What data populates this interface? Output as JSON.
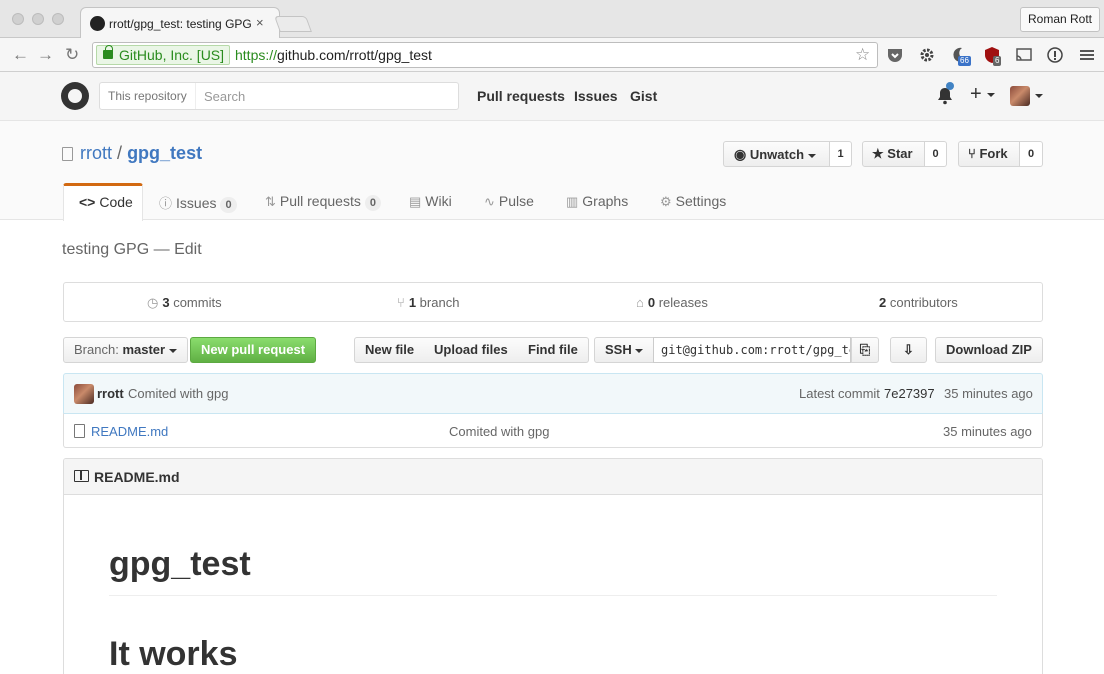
{
  "browser": {
    "tab_title": "rrott/gpg_test: testing GPG",
    "tab_close": "×",
    "profile_name": "Roman Rott",
    "ev_label": "GitHub, Inc. [US]",
    "url_scheme": "https://",
    "url_rest": "github.com/rrott/gpg_test",
    "nav_back": "←",
    "nav_forward": "→",
    "nav_reload": "↻",
    "bookmark_star": "☆",
    "ext_badge_moon": "66",
    "ext_badge_ublock": "6"
  },
  "gh_header": {
    "search_scope": "This repository",
    "search_placeholder": "Search",
    "nav": [
      "Pull requests",
      "Issues",
      "Gist"
    ],
    "plus_glyph": "+"
  },
  "repo": {
    "owner": "rrott",
    "separator": "/",
    "name": "gpg_test",
    "watch_label": "Unwatch",
    "watch_count": "1",
    "star_label": "Star",
    "star_count": "0",
    "fork_label": "Fork",
    "fork_count": "0",
    "tabs": [
      {
        "label": "Code",
        "icon": "<>"
      },
      {
        "label": "Issues",
        "count": "0"
      },
      {
        "label": "Pull requests",
        "count": "0"
      },
      {
        "label": "Wiki"
      },
      {
        "label": "Pulse"
      },
      {
        "label": "Graphs"
      },
      {
        "label": "Settings"
      }
    ],
    "description": "testing GPG",
    "desc_sep": "—",
    "edit_label": "Edit"
  },
  "summary": {
    "commits_count": "3",
    "commits_label": "commits",
    "branch_count": "1",
    "branch_label": "branch",
    "releases_count": "0",
    "releases_label": "releases",
    "contributors_count": "2",
    "contributors_label": "contributors"
  },
  "filebar": {
    "branch_prefix": "Branch:",
    "branch_name": "master",
    "new_pr": "New pull request",
    "new_file": "New file",
    "upload_files": "Upload files",
    "find_file": "Find file",
    "clone_protocol": "SSH",
    "clone_url": "git@github.com:rrott/gpg_test.git",
    "download_zip": "Download ZIP"
  },
  "commit": {
    "author": "rrott",
    "message": "Comited with gpg",
    "latest_label": "Latest commit",
    "sha": "7e27397",
    "age": "35 minutes ago"
  },
  "files": [
    {
      "name": "README.md",
      "message": "Comited with gpg",
      "age": "35 minutes ago"
    }
  ],
  "readme": {
    "filename": "README.md",
    "heading1": "gpg_test",
    "heading2": "It works"
  },
  "colors": {
    "link": "#4078c0",
    "selected_tab_border": "#d26911",
    "new_pr_green": "#60b044",
    "ev_green": "#2a8c1e"
  }
}
